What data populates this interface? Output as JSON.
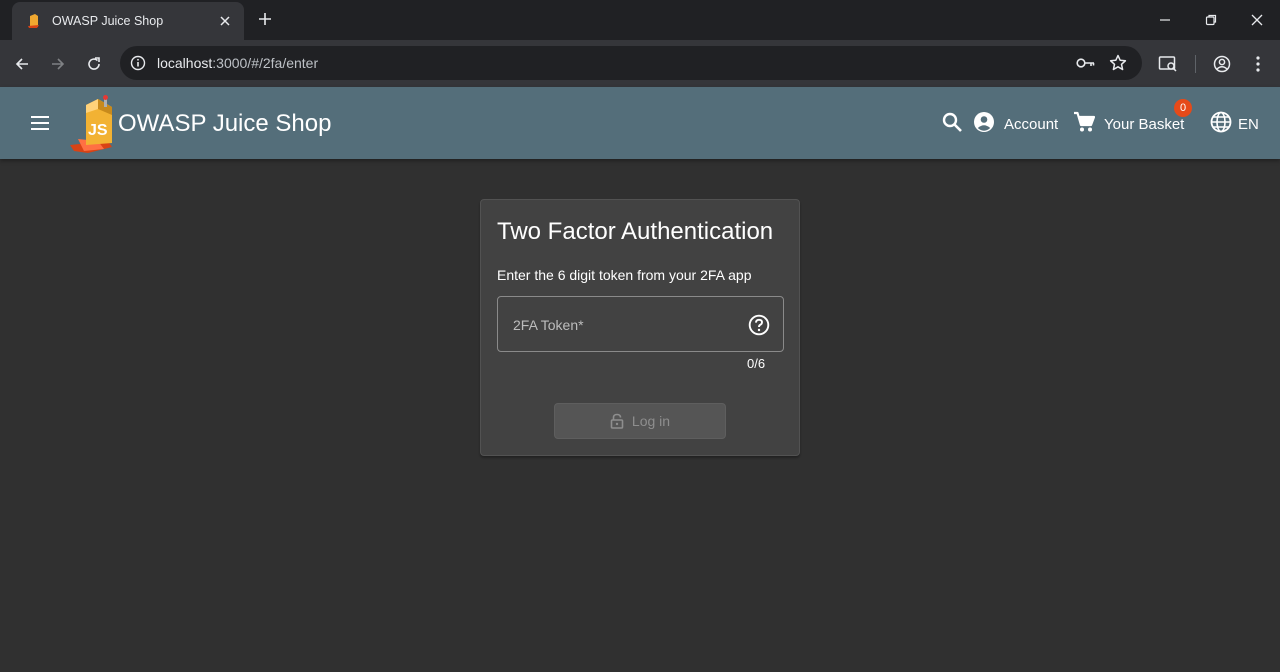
{
  "browser": {
    "tab_title": "OWASP Juice Shop",
    "url_host": "localhost",
    "url_path": ":3000/#/2fa/enter"
  },
  "header": {
    "title": "OWASP Juice Shop",
    "account_label": "Account",
    "basket_label": "Your Basket",
    "basket_count": "0",
    "language": "EN"
  },
  "card": {
    "title": "Two Factor Authentication",
    "description": "Enter the 6 digit token from your 2FA app",
    "token_label": "2FA Token*",
    "token_value": "",
    "counter": "0/6",
    "login_label": "Log in"
  },
  "colors": {
    "appbar": "#546e7a",
    "background": "#303030",
    "card": "#424242",
    "badge": "#e64a19"
  }
}
